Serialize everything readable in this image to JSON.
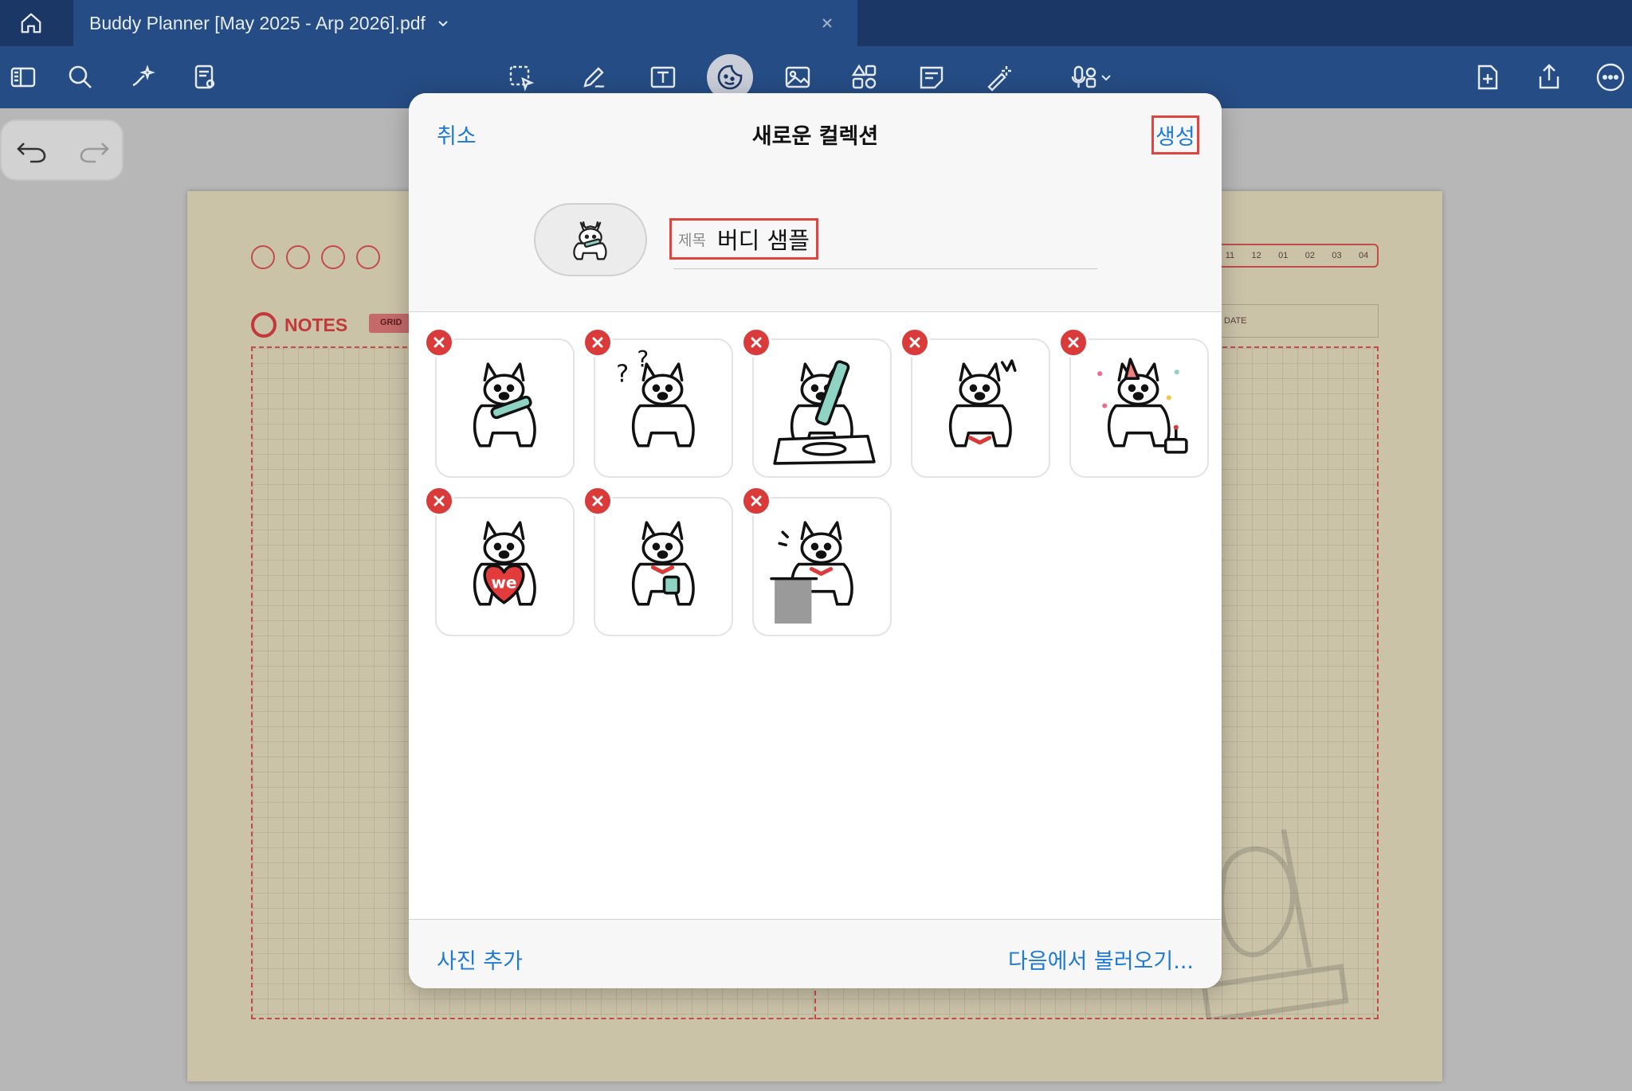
{
  "tabbar": {
    "document_title": "Buddy Planner [May 2025 - Arp 2026].pdf"
  },
  "planner": {
    "notes_label": "NOTES",
    "grid_tag": "GRID",
    "months": [
      "11",
      "12",
      "01",
      "02",
      "03",
      "04"
    ],
    "date_label": "DATE"
  },
  "modal": {
    "cancel_label": "취소",
    "title": "새로운 컬렉션",
    "create_label": "생성",
    "title_field_label": "제목",
    "title_field_value": "버디 샘플",
    "add_photo_label": "사진 추가",
    "import_from_label": "다음에서 불러오기..."
  },
  "stickers": [
    {
      "icon": "dog-with-pencil-icon",
      "text": ""
    },
    {
      "icon": "dog-question-marks-icon",
      "text": ""
    },
    {
      "icon": "dog-drawing-icon",
      "text": ""
    },
    {
      "icon": "dog-startled-icon",
      "text": ""
    },
    {
      "icon": "dog-party-hat-cake-icon",
      "text": ""
    },
    {
      "icon": "dog-heart-we-icon",
      "text": "we"
    },
    {
      "icon": "dog-coffee-cup-icon",
      "text": ""
    },
    {
      "icon": "dog-at-desk-icon",
      "text": ""
    }
  ],
  "colors": {
    "tab_bar": "#1b3765",
    "toolbar": "#254c84",
    "link_blue": "#1e7ad6",
    "highlight_red": "#e0443e",
    "delete_red": "#d93a3a",
    "planner_red": "#c34b4b"
  }
}
